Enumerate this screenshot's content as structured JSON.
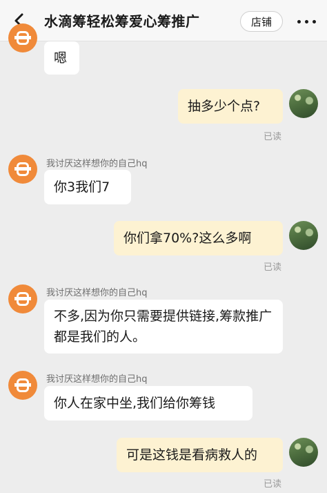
{
  "header": {
    "title": "水滴筹轻松筹爱心筹推广",
    "shop_label": "店铺"
  },
  "messages": [
    {
      "side": "in",
      "sender": "",
      "text": "嗯"
    },
    {
      "side": "out",
      "text": "抽多少个点?",
      "status": "已读"
    },
    {
      "side": "in",
      "sender": "我讨厌这样想你的自己hq",
      "text": "你3我们7"
    },
    {
      "side": "out",
      "text": "你们拿70%?这么多啊",
      "status": "已读"
    },
    {
      "side": "in",
      "sender": "我讨厌这样想你的自己hq",
      "text": "不多,因为你只需要提供链接,筹款推广都是我们的人。"
    },
    {
      "side": "in",
      "sender": "我讨厌这样想你的自己hq",
      "text": "你人在家中坐,我们给你筹钱"
    },
    {
      "side": "out",
      "text": "可是这钱是看病救人的",
      "status": "已读"
    }
  ]
}
